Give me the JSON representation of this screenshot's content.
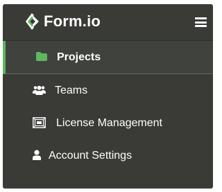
{
  "brand": {
    "name": "Form.io",
    "logo_icon": "formio-logo-icon",
    "accent_color": "#5fb75f"
  },
  "header": {
    "menu_icon": "hamburger-menu-icon"
  },
  "nav": {
    "items": [
      {
        "label": "Projects",
        "icon": "folder-icon",
        "active": true
      },
      {
        "label": "Teams",
        "icon": "users-icon",
        "active": false
      },
      {
        "label": "License Management",
        "icon": "license-icon",
        "active": false
      },
      {
        "label": "Account Settings",
        "icon": "user-icon",
        "active": false
      }
    ]
  }
}
